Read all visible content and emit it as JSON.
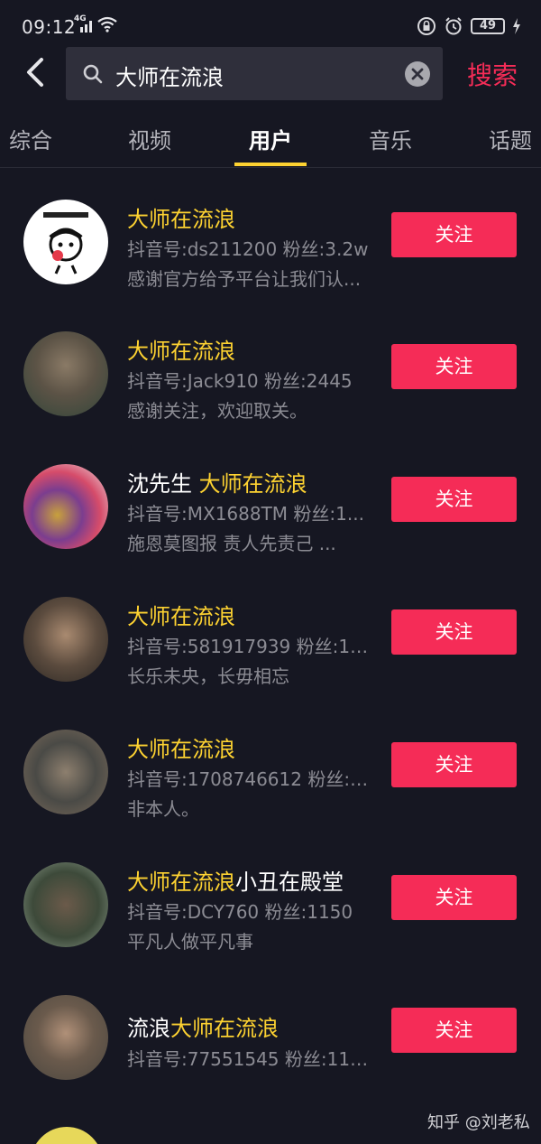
{
  "status": {
    "time": "09:12",
    "network": "4G",
    "battery": "49"
  },
  "search": {
    "query": "大师在流浪",
    "submit_label": "搜索"
  },
  "tabs": [
    {
      "label": "综合",
      "active": false
    },
    {
      "label": "视频",
      "active": false
    },
    {
      "label": "用户",
      "active": true
    },
    {
      "label": "音乐",
      "active": false
    },
    {
      "label": "话题",
      "active": false
    }
  ],
  "users": [
    {
      "name_prefix": "",
      "name_highlight": "大师在流浪",
      "name_suffix": "",
      "meta": "抖音号:ds211200 粉丝:3.2w",
      "desc": "感谢官方给予平台让我们认...",
      "follow_label": "关注"
    },
    {
      "name_prefix": "",
      "name_highlight": "大师在流浪",
      "name_suffix": "",
      "meta": "抖音号:Jack910 粉丝:2445",
      "desc": "感谢关注，欢迎取关。",
      "follow_label": "关注"
    },
    {
      "name_prefix": "沈先生 ",
      "name_highlight": "大师在流浪",
      "name_suffix": "",
      "meta": "抖音号:MX1688TM 粉丝:1...",
      "desc": "施恩莫图报 责人先责己 ...",
      "follow_label": "关注"
    },
    {
      "name_prefix": "",
      "name_highlight": "大师在流浪",
      "name_suffix": "",
      "meta": "抖音号:581917939 粉丝:1....",
      "desc": "长乐未央，长毋相忘",
      "follow_label": "关注"
    },
    {
      "name_prefix": "",
      "name_highlight": "大师在流浪",
      "name_suffix": "",
      "meta": "抖音号:1708746612 粉丝:2...",
      "desc": "非本人。",
      "follow_label": "关注"
    },
    {
      "name_prefix": "",
      "name_highlight": "大师在流浪",
      "name_suffix": "小丑在殿堂",
      "meta": "抖音号:DCY760 粉丝:1150",
      "desc": "平凡人做平凡事",
      "follow_label": "关注"
    },
    {
      "name_prefix": "流浪",
      "name_highlight": "大师在流浪",
      "name_suffix": "",
      "meta": "抖音号:77551545 粉丝:1151",
      "desc": "",
      "follow_label": "关注"
    }
  ],
  "watermark": "知乎 @刘老私",
  "colors": {
    "background": "#161722",
    "accent": "#f52c57",
    "highlight": "#fdd231"
  }
}
